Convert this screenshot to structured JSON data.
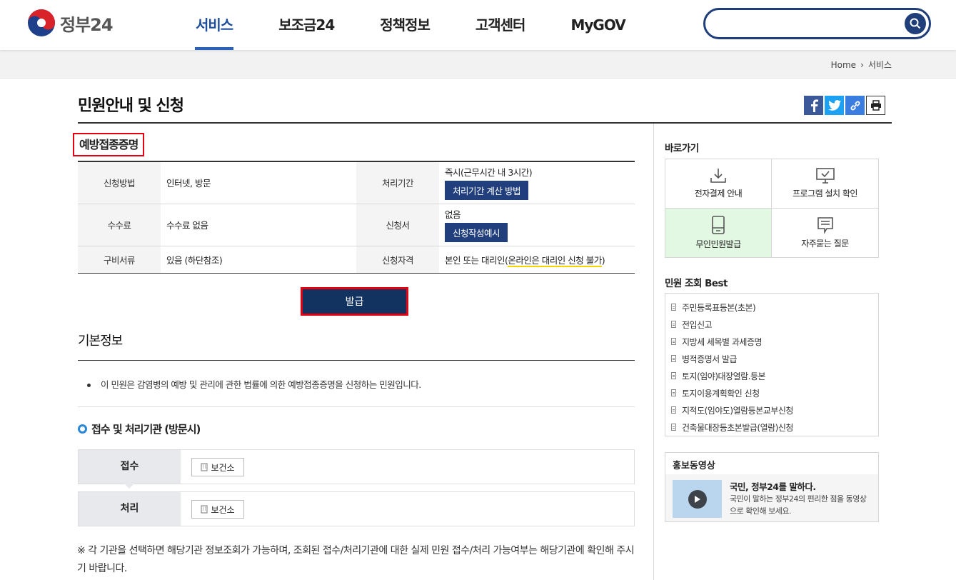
{
  "header": {
    "logo_text": "정부24",
    "nav": [
      "서비스",
      "보조금24",
      "정책정보",
      "고객센터",
      "MyGOV"
    ],
    "search_placeholder": ""
  },
  "breadcrumb": {
    "home": "Home",
    "current": "서비스"
  },
  "page_title": "민원안내 및 신청",
  "service_name": "예방접종증명",
  "info": {
    "method_label": "신청방법",
    "method_value": "인터넷, 방문",
    "period_label": "처리기간",
    "period_value": "즉시(근무시간 내 3시간)",
    "period_btn": "처리기간 계산 방법",
    "fee_label": "수수료",
    "fee_value": "수수료 없음",
    "form_label": "신청서",
    "form_value": "없음",
    "form_btn": "신청작성예시",
    "docs_label": "구비서류",
    "docs_value": "있음 (하단참조)",
    "qual_label": "신청자격",
    "qual_value_a": "본인 또는 대리인(",
    "qual_value_b": "온라인은 대리인 신청 불가",
    "qual_value_c": ")"
  },
  "issue_button": "발급",
  "basic_info": {
    "title": "기본정보",
    "desc": "이 민원은 감염병의 예방 및 관리에 관한 법률에 의한 예방접종증명을 신청하는 민원입니다."
  },
  "agency": {
    "title": "접수 및 처리기관 (방문시)",
    "receive_label": "접수",
    "receive_org": "보건소",
    "process_label": "처리",
    "process_org": "보건소",
    "notice": "※ 각 기관을 선택하면 해당기관 정보조회가 가능하며, 조회된 접수/처리기관에 대한 실제 민원 접수/처리 가능여부는 해당기관에 확인해 주시기 바랍니다."
  },
  "sidebar": {
    "quick_title": "바로가기",
    "quick": [
      "전자결제 안내",
      "프로그램 설치 확인",
      "무인민원발급",
      "자주묻는 질문"
    ],
    "best_title": "민원 조회 Best",
    "best": [
      "주민등록표등본(초본)",
      "전입신고",
      "지방세 세목별 과세증명",
      "병적증명서 발급",
      "토지(임야)대장열람.등본",
      "토지이용계획확인 신청",
      "지적도(임야도)열람등본교부신청",
      "건축물대장등초본발급(열람)신청"
    ],
    "promo_title": "홍보동영상",
    "promo_video_title": "국민, 정부24를 말하다.",
    "promo_video_desc": "국민이 말하는 정부24의 편리한 점을 동영상으로 확인해 보세요."
  },
  "colors": {
    "brand": "#1f3e7a",
    "accent": "#2a62b7",
    "highlight_border": "#e50012"
  }
}
